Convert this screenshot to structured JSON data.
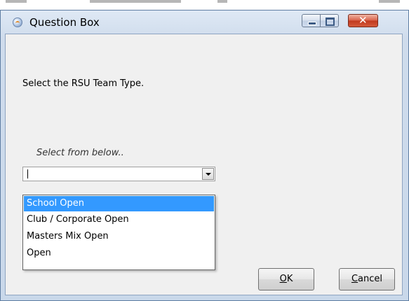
{
  "window": {
    "title": "Question Box",
    "icon": "app-icon",
    "controls": {
      "minimize_icon": "minimize-icon",
      "maximize_icon": "maximize-icon",
      "close_icon": "close-icon",
      "close_glyph": "✕"
    }
  },
  "dialog": {
    "prompt": "Select the RSU Team Type.",
    "select_caption": "Select from below..",
    "combo": {
      "value": "",
      "arrow_icon": "chevron-down-icon"
    },
    "options": [
      {
        "label": "School Open",
        "selected": true
      },
      {
        "label": "Club / Corporate Open",
        "selected": false
      },
      {
        "label": "Masters Mix Open",
        "selected": false
      },
      {
        "label": "Open",
        "selected": false
      }
    ],
    "buttons": {
      "ok_mnemonic": "O",
      "ok_rest": "K",
      "cancel_mnemonic": "C",
      "cancel_rest": "ancel"
    }
  },
  "colors": {
    "selection": "#3399ff",
    "title_bar": "#cfdcec",
    "close_button": "#c13a1f"
  }
}
